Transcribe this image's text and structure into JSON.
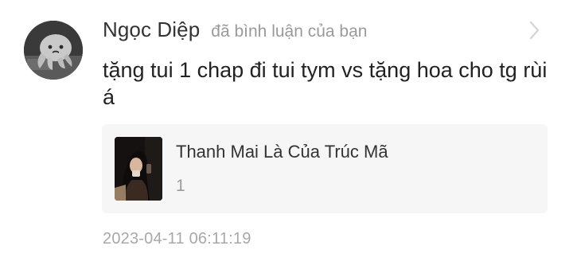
{
  "notification": {
    "avatar_icon": "octopus-plush-avatar",
    "username": "Ngọc Diệp",
    "action_text": "đã bình luận của bạn",
    "chevron_icon": "chevron-right-icon",
    "comment": "tặng tui 1 chap đi tui tym vs tặng hoa cho tg rùi á",
    "story": {
      "thumbnail_icon": "story-cover-image",
      "title": "Thanh Mai Là Của Trúc Mã",
      "chapter": "1"
    },
    "timestamp": "2023-04-11 06:11:19"
  },
  "colors": {
    "username": "#333333",
    "muted": "#9a9a9a",
    "card_background": "#f6f6f6",
    "comment_text": "#222222"
  }
}
